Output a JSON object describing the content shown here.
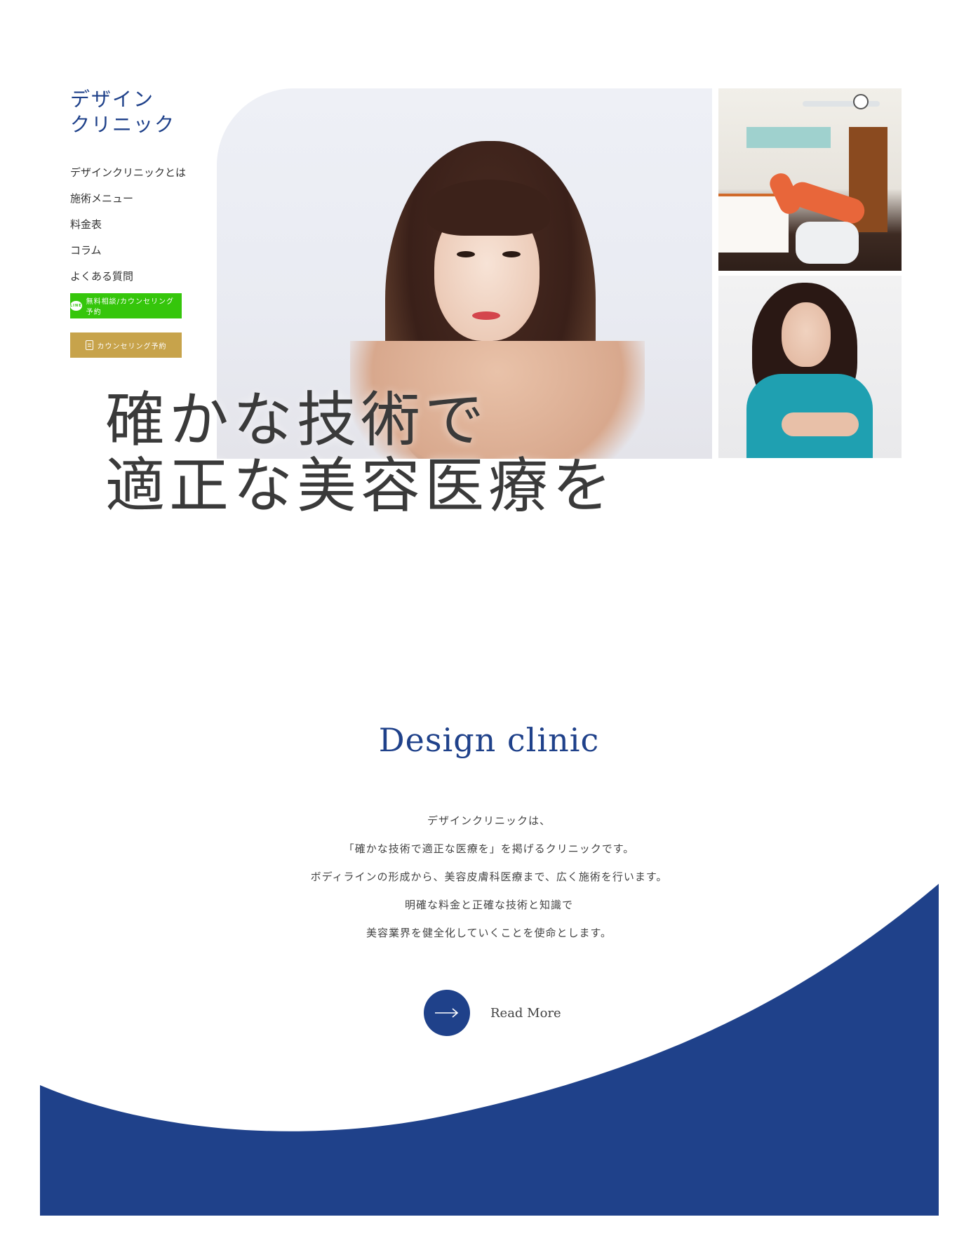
{
  "brand": {
    "line1": "デザイン",
    "line2": "クリニック"
  },
  "nav": {
    "items": [
      {
        "label": "デザインクリニックとは"
      },
      {
        "label": "施術メニュー"
      },
      {
        "label": "料金表"
      },
      {
        "label": "コラム"
      },
      {
        "label": "よくある質問"
      }
    ]
  },
  "cta": {
    "line_icon_text": "LINE",
    "line_label": "無料相談/カウンセリング予約",
    "counsel_label": "カウンセリング予約"
  },
  "hero": {
    "headline_line1": "確かな技術で",
    "headline_line2": "適正な美容医療を"
  },
  "about": {
    "title": "Design clinic",
    "lines": [
      "デザインクリニックは、",
      "「確かな技術で適正な医療を」を掲げるクリニックです。",
      "ボディラインの形成から、美容皮膚科医療まで、広く施術を行います。",
      "明確な料金と正確な技術と知識で",
      "美容業界を健全化していくことを使命とします。"
    ],
    "read_more": "Read More"
  },
  "colors": {
    "brand_blue": "#1f418a",
    "line_green": "#35c60b",
    "gold": "#c7a34b"
  },
  "icons": {
    "line": "line-icon",
    "counsel": "document-icon",
    "read_more": "arrow-right-icon"
  }
}
